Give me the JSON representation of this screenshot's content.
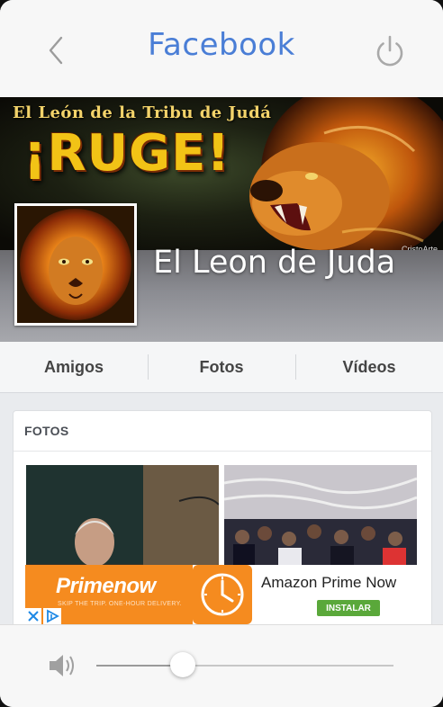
{
  "header": {
    "title": "Facebook"
  },
  "cover": {
    "tagline": "El León de la Tribu de Judá",
    "headline": "¡RUGE!",
    "credit": "CristoArte",
    "page_name": "El Leon de Juda"
  },
  "tabs": [
    {
      "label": "Amigos"
    },
    {
      "label": "Fotos"
    },
    {
      "label": "Vídeos"
    }
  ],
  "photos": {
    "heading": "FOTOS"
  },
  "ad": {
    "brand": "Primenow",
    "tagline": "SKIP THE TRIP. ONE-HOUR DELIVERY.",
    "title": "Amazon Prime Now",
    "install_label": "INSTALAR"
  },
  "volume": {
    "level": 0.29
  },
  "colors": {
    "title_blue": "#4a7ed6",
    "ad_orange": "#f58b1f",
    "install_green": "#5aa83a"
  }
}
